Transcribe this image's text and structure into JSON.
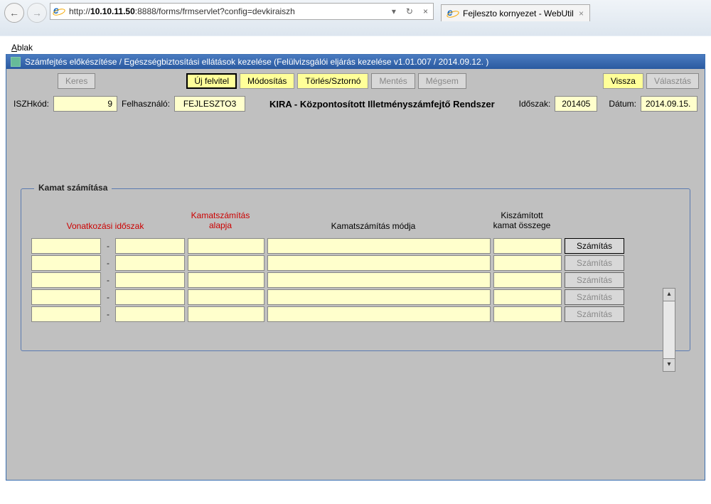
{
  "browser": {
    "url_display_prefix": "http://",
    "url_host": "10.10.11.50",
    "url_suffix": ":8888/forms/frmservlet?config=devkiraiszh",
    "refresh_glyph": "↻",
    "stop_glyph": "×",
    "tab_label": "Fejleszto kornyezet - WebUtil",
    "tab_close": "×",
    "back": "←",
    "forward": "→",
    "dropdown": "▾"
  },
  "menu": {
    "ablak_prefix": "A",
    "ablak_rest": "blak"
  },
  "titlebar": "Számfejtés előkészítése / Egészségbiztosítási ellátások kezelése (Felülvizsgálói eljárás kezelése v1.01.007 / 2014.09.12. )",
  "toolbar": {
    "keres": "Keres",
    "uj": "Új felvitel",
    "modositas": "Módosítás",
    "torles": "Törlés/Sztornó",
    "mentes": "Mentés",
    "megsem": "Mégsem",
    "vissza": "Vissza",
    "valasztas": "Választás"
  },
  "info": {
    "iszhkod_label": "ISZHkód:",
    "iszhkod_value": "9",
    "felhasznalo_label": "Felhasználó:",
    "felhasznalo_value": "FEJLESZTO3",
    "main_title": "KIRA - Központosított Illetményszámfejtő Rendszer",
    "idoszak_label": "Időszak:",
    "idoszak_value": "201405",
    "datum_label": "Dátum:",
    "datum_value": "2014.09.15."
  },
  "panel": {
    "legend": "Kamat számítása",
    "hdr_vonatkozasi": "Vonatkozási időszak",
    "hdr_alapja": "Kamatszámítás alapja",
    "hdr_modja": "Kamatszámítás módja",
    "hdr_osszeg": "Kiszámított kamat összege",
    "sep": "-",
    "btn_label": "Számítás",
    "scroll_up": "▴",
    "scroll_down": "▾"
  }
}
